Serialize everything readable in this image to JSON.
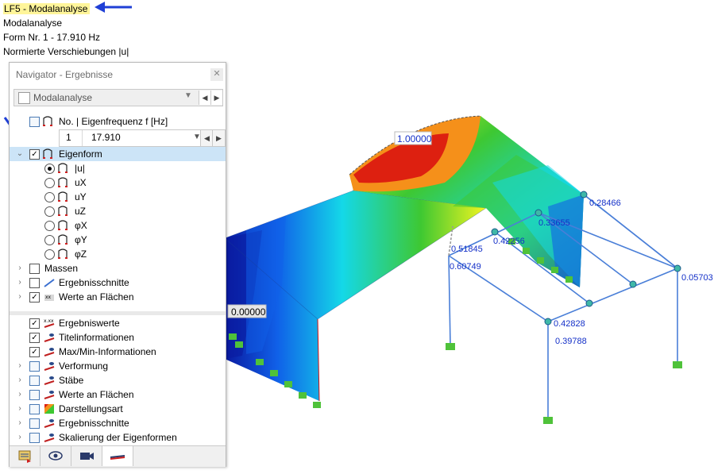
{
  "header": {
    "load_case": "LF5 - Modalanalyse",
    "analysis": "Modalanalyse",
    "form": "Form Nr. 1 - 17.910 Hz",
    "quantity": "Normierte Verschiebungen |u|"
  },
  "navigator": {
    "title": "Navigator - Ergebnisse",
    "close_glyph": "✕",
    "combo_value": "Modalanalyse",
    "freq_header": "No. | Eigenfrequenz f [Hz]",
    "freq_no": "1",
    "freq_value": "17.910",
    "eigenform": "Eigenform",
    "options": [
      "|u|",
      "uX",
      "uY",
      "uZ",
      "φX",
      "φY",
      "φZ"
    ],
    "selected_option": "|u|",
    "top_items": [
      "Massen",
      "Ergebnisschnitte",
      "Werte an Flächen"
    ],
    "top_items_checked": [
      false,
      false,
      true
    ],
    "bottom_items": [
      "Ergebniswerte",
      "Titelinformationen",
      "Max/Min-Informationen",
      "Verformung",
      "Stäbe",
      "Werte an Flächen",
      "Darstellungsart",
      "Ergebnisschnitte",
      "Skalierung der Eigenformen"
    ],
    "bottom_items_checked": [
      true,
      true,
      true,
      false,
      false,
      false,
      false,
      false,
      false
    ],
    "bottom_items_expandable": [
      false,
      false,
      false,
      true,
      true,
      true,
      true,
      true,
      true
    ],
    "tab_icons": [
      "data-icon",
      "eye-icon",
      "camera-icon",
      "results-icon"
    ]
  },
  "model": {
    "max_label": "1.00000",
    "min_label": "0.00000",
    "value_labels": [
      "0.28466",
      "0.33655",
      "0.42256",
      "0.51845",
      "0.60749",
      "0.05703",
      "0.42828",
      "0.39788"
    ],
    "colors": {
      "red": "#dd2010",
      "orange": "#f5901a",
      "yellow": "#f3f520",
      "green": "#3ec832",
      "cyan": "#14d8e8",
      "blue": "#1060e8",
      "navy": "#0a1aa0",
      "member": "#4a7fd8",
      "annotation": "#1430c8",
      "arrow": "#1f3fd6"
    }
  }
}
